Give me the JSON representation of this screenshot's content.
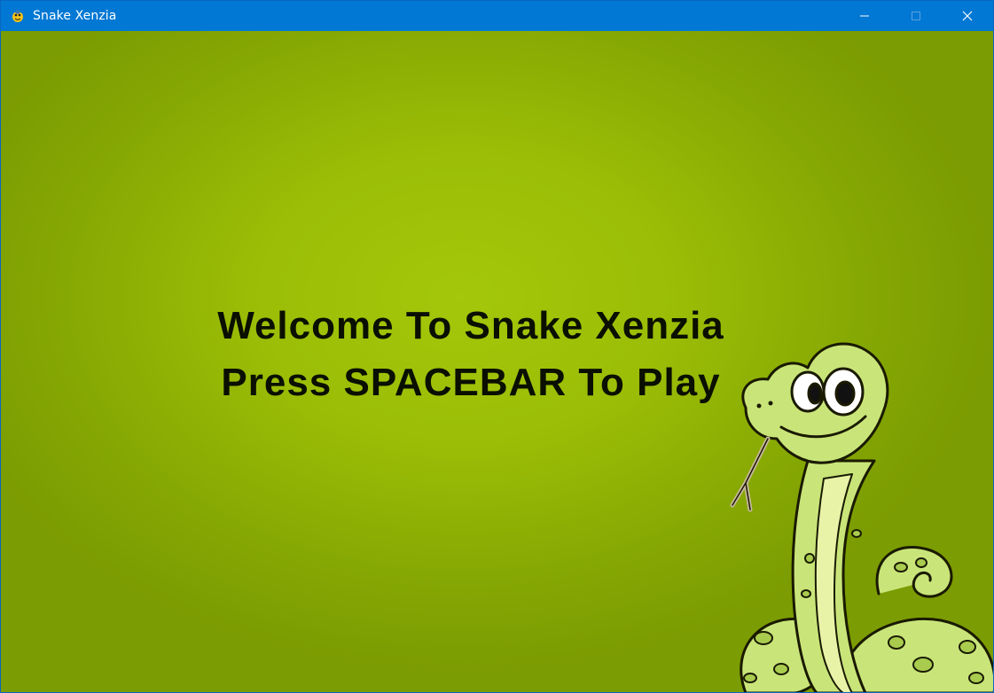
{
  "window": {
    "title": "Snake Xenzia",
    "app_icon": "python-snake-icon",
    "titlebar_color": "#0078d4",
    "controls": {
      "minimize": "minimize-icon",
      "maximize": "maximize-icon",
      "close": "close-icon"
    }
  },
  "game": {
    "background_color": "#9cbf06",
    "welcome_line": "Welcome To Snake Xenzia",
    "instruction_line": "Press SPACEBAR To Play",
    "text_color": "#0b0f00",
    "mascot": "cartoon-snake-illustration"
  }
}
